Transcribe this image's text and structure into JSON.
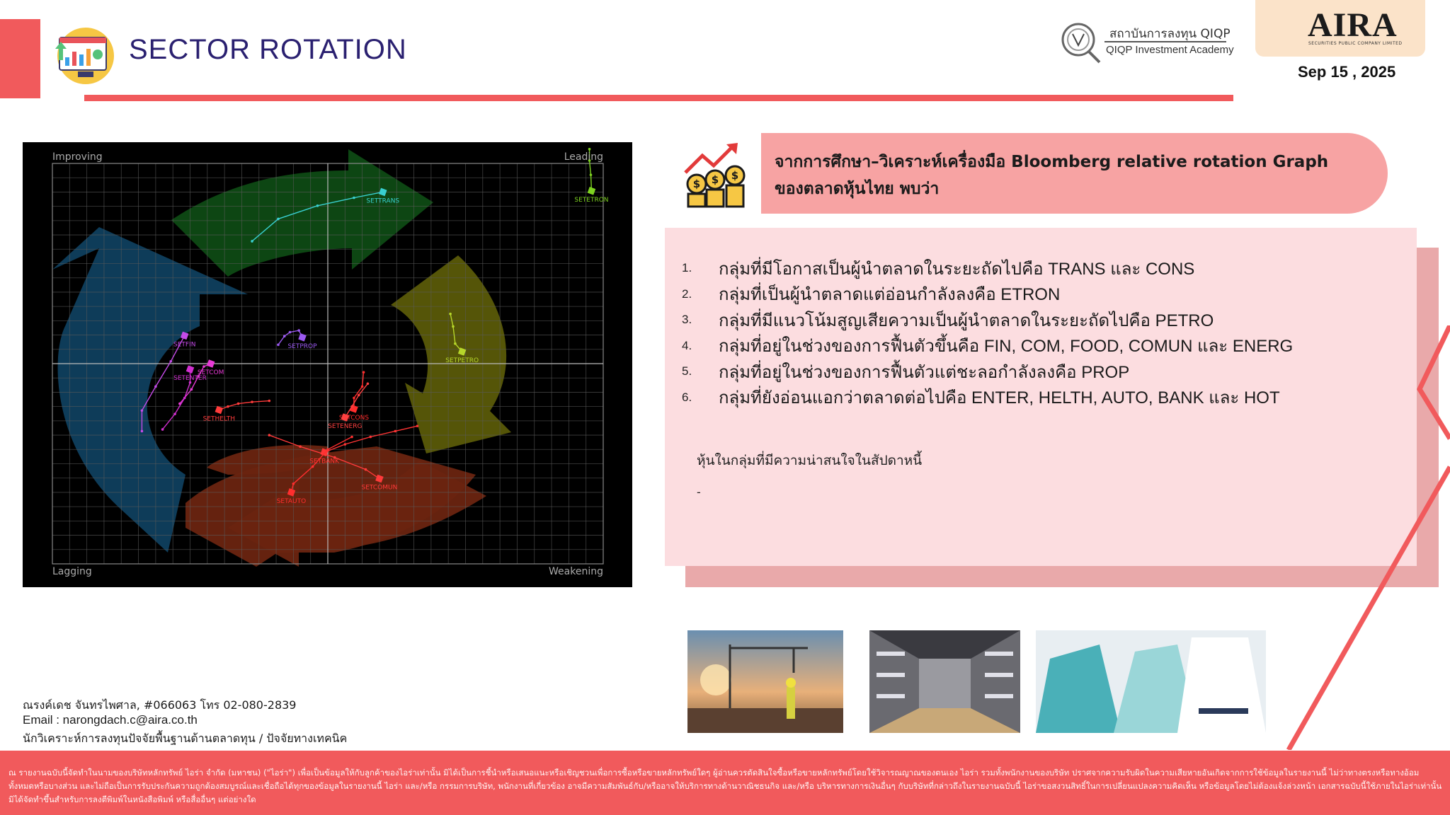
{
  "header": {
    "title": "SECTOR ROTATION",
    "qiqp_thai": "สถาบันการลงทุน QIQP",
    "qiqp_english": "QIQP Investment Academy",
    "brand": "AIRA",
    "brand_sub": "SECURITIES PUBLIC COMPANY LIMITED",
    "date": "Sep 15 , 2025"
  },
  "colors": {
    "accent": "#f15a5c",
    "title_text": "#2a2070",
    "pill": "#f7a3a3",
    "box": "#fcdde0",
    "box_shadow": "#e9a9aa",
    "brand_box": "#fbe3c9"
  },
  "chart_data": {
    "type": "scatter",
    "title": "",
    "xlabel": "",
    "ylabel": "",
    "xlim": [
      96,
      104
    ],
    "ylim": [
      96.5,
      103.5
    ],
    "grid": true,
    "quadrants": [
      "Improving",
      "Leading",
      "Lagging",
      "Weakening"
    ],
    "quadrant_colors": {
      "Improving": "#0f3f5e",
      "Leading": "#0e4a14",
      "Lagging": "#6a2410",
      "Weakening": "#5a5a08"
    },
    "series": [
      {
        "name": "SETTRANS",
        "color": "#39cfd0",
        "tail": [
          [
            98.9,
            102.14
          ],
          [
            99.28,
            102.53
          ],
          [
            99.85,
            102.76
          ],
          [
            100.38,
            102.9
          ],
          [
            100.8,
            103.0
          ]
        ]
      },
      {
        "name": "SETETRON",
        "color": "#7ed321",
        "tail": [
          [
            103.8,
            103.75
          ],
          [
            103.8,
            103.55
          ],
          [
            103.82,
            103.3
          ],
          [
            103.83,
            103.02
          ]
        ]
      },
      {
        "name": "SETPETRO",
        "color": "#b6d62a",
        "tail": [
          [
            101.78,
            100.87
          ],
          [
            101.82,
            100.65
          ],
          [
            101.85,
            100.35
          ],
          [
            101.95,
            100.21
          ]
        ]
      },
      {
        "name": "SETPROP",
        "color": "#9b59f0",
        "tail": [
          [
            99.28,
            100.33
          ],
          [
            99.37,
            100.48
          ],
          [
            99.45,
            100.55
          ],
          [
            99.58,
            100.58
          ],
          [
            99.63,
            100.46
          ]
        ]
      },
      {
        "name": "SETFIN",
        "color": "#c44be8",
        "tail": [
          [
            97.3,
            98.82
          ],
          [
            97.3,
            99.18
          ],
          [
            97.5,
            99.6
          ],
          [
            97.72,
            100.04
          ],
          [
            97.92,
            100.49
          ]
        ]
      },
      {
        "name": "SETCOM",
        "color": "#e83ad6",
        "tail": [
          [
            97.85,
            99.3
          ],
          [
            98.02,
            99.55
          ],
          [
            98.12,
            99.78
          ],
          [
            98.2,
            99.95
          ],
          [
            98.3,
            100.0
          ]
        ]
      },
      {
        "name": "SETENTER",
        "color": "#d12fd0",
        "tail": [
          [
            97.6,
            98.85
          ],
          [
            97.78,
            99.12
          ],
          [
            97.92,
            99.4
          ],
          [
            98.0,
            99.67
          ],
          [
            98.0,
            99.9
          ]
        ]
      },
      {
        "name": "SETHELTH",
        "color": "#ff3b3b",
        "tail": [
          [
            99.15,
            99.35
          ],
          [
            98.9,
            99.33
          ],
          [
            98.7,
            99.3
          ],
          [
            98.55,
            99.25
          ],
          [
            98.42,
            99.19
          ]
        ]
      },
      {
        "name": "SETCONS",
        "color": "#ff2d2d",
        "tail": [
          [
            100.52,
            99.85
          ],
          [
            100.5,
            99.6
          ],
          [
            100.38,
            99.4
          ],
          [
            100.38,
            99.21
          ]
        ]
      },
      {
        "name": "SETENERG",
        "color": "#ff4040",
        "tail": [
          [
            100.58,
            99.65
          ],
          [
            100.45,
            99.45
          ],
          [
            100.35,
            99.25
          ],
          [
            100.25,
            99.06
          ]
        ]
      },
      {
        "name": "SETBANK",
        "color": "#ff3434",
        "tail": [
          [
            101.3,
            98.91
          ],
          [
            100.98,
            98.82
          ],
          [
            100.62,
            98.72
          ],
          [
            100.25,
            98.59
          ],
          [
            99.95,
            98.45
          ]
        ]
      },
      {
        "name": "SETCOMUN",
        "color": "#ff3a3a",
        "tail": [
          [
            99.15,
            98.75
          ],
          [
            99.6,
            98.55
          ],
          [
            100.1,
            98.36
          ],
          [
            100.55,
            98.15
          ],
          [
            100.75,
            97.99
          ]
        ]
      },
      {
        "name": "SETAUTO",
        "color": "#ff2e2e",
        "tail": [
          [
            100.35,
            98.72
          ],
          [
            100.0,
            98.5
          ],
          [
            99.78,
            98.2
          ],
          [
            99.5,
            97.9
          ],
          [
            99.47,
            97.75
          ]
        ]
      }
    ]
  },
  "findings": {
    "heading_line1": "จากการศึกษา–วิเคราะห์เครื่องมือ Bloomberg relative rotation Graph",
    "heading_line2": "ของตลาดหุ้นไทย พบว่า",
    "items": [
      {
        "num": "1.",
        "text": "กลุ่มที่มีโอกาสเป็นผู้นำตลาดในระยะถัดไปคือ TRANS และ CONS"
      },
      {
        "num": "2.",
        "text": "กลุ่มที่เป็นผู้นำตลาดแต่อ่อนกำลังลงคือ ETRON"
      },
      {
        "num": "3.",
        "text": "กลุ่มที่มีแนวโน้มสูญเสียความเป็นผู้นำตลาดในระยะถัดไปคือ PETRO"
      },
      {
        "num": "4.",
        "text": "กลุ่มที่อยู่ในช่วงของการฟื้นตัวขึ้นคือ FIN, COM, FOOD, COMUN และ ENERG"
      },
      {
        "num": "5.",
        "text": "กลุ่มที่อยู่ในช่วงของการฟื้นตัวแต่ชะลอกำลังลงคือ PROP"
      },
      {
        "num": "6.",
        "text": "กลุ่มที่ยังอ่อนแอกว่าตลาดต่อไปคือ ENTER, HELTH, AUTO, BANK และ HOT"
      }
    ],
    "interest_label": "หุ้นในกลุ่มที่มีความน่าสนใจในสัปดาหนี้",
    "interest_value": "-"
  },
  "contact": {
    "name_line": "ณรงค์เดช จันทรไพศาล, #066063  โทร 02-080-2839",
    "email_line": "Email : narongdach.c@aira.co.th",
    "role_line": "นักวิเคราะห์การลงทุนปัจจัยพื้นฐานด้านตลาดทุน / ปัจจัยทางเทคนิค"
  },
  "footer": {
    "disclaimer": "ณ รายงานฉบับนี้จัดทำในนามของบริษัทหลักทรัพย์ ไอร่า จำกัด (มหาชน) (\"ไอร่า\") เพื่อเป็นข้อมูลให้กับลูกค้าของไอร่าเท่านั้น มิได้เป็นการชี้นำหรือเสนอแนะหรือเชิญชวนเพื่อการซื้อหรือขายหลักทรัพย์ใดๆ ผู้อ่านควรตัดสินใจซื้อหรือขายหลักทรัพย์โดยใช้วิจารณญาณของตนเอง ไอร่า รวมทั้งพนักงานของบริษัท ปราศจากความรับผิดในความเสียหายอันเกิดจากการใช้ข้อมูลในรายงานนี้ ไม่ว่าทางตรงหรือทางอ้อม ทั้งหมดหรือบางส่วน และไม่ถือเป็นการรับประกันความถูกต้องสมบูรณ์และเชื่อถือได้ทุกของข้อมูลในรายงานนี้ ไอร่า และ/หรือ กรรมการบริษัท, พนักงานที่เกี่ยวข้อง อาจมีความสัมพันธ์กับ/หรืออาจให้บริการทางด้านวาณิชธนกิจ และ/หรือ บริหารทางการเงินอื่นๆ กับบริษัทที่กล่าวถึงในรายงานฉบับนี้ ไอร่าขอสงวนสิทธิ์ในการเปลี่ยนแปลงความคิดเห็น หรือข้อมูลโดยไม่ต้องแจ้งล่วงหน้า เอกสารฉบับนี้ใช้ภายในไอร่าเท่านั้น มิได้จัดทำขึ้นสำหรับการลงตีพิมพ์ในหนังสือพิมพ์ หรือสื่ออื่นๆ แต่อย่างใด"
  }
}
